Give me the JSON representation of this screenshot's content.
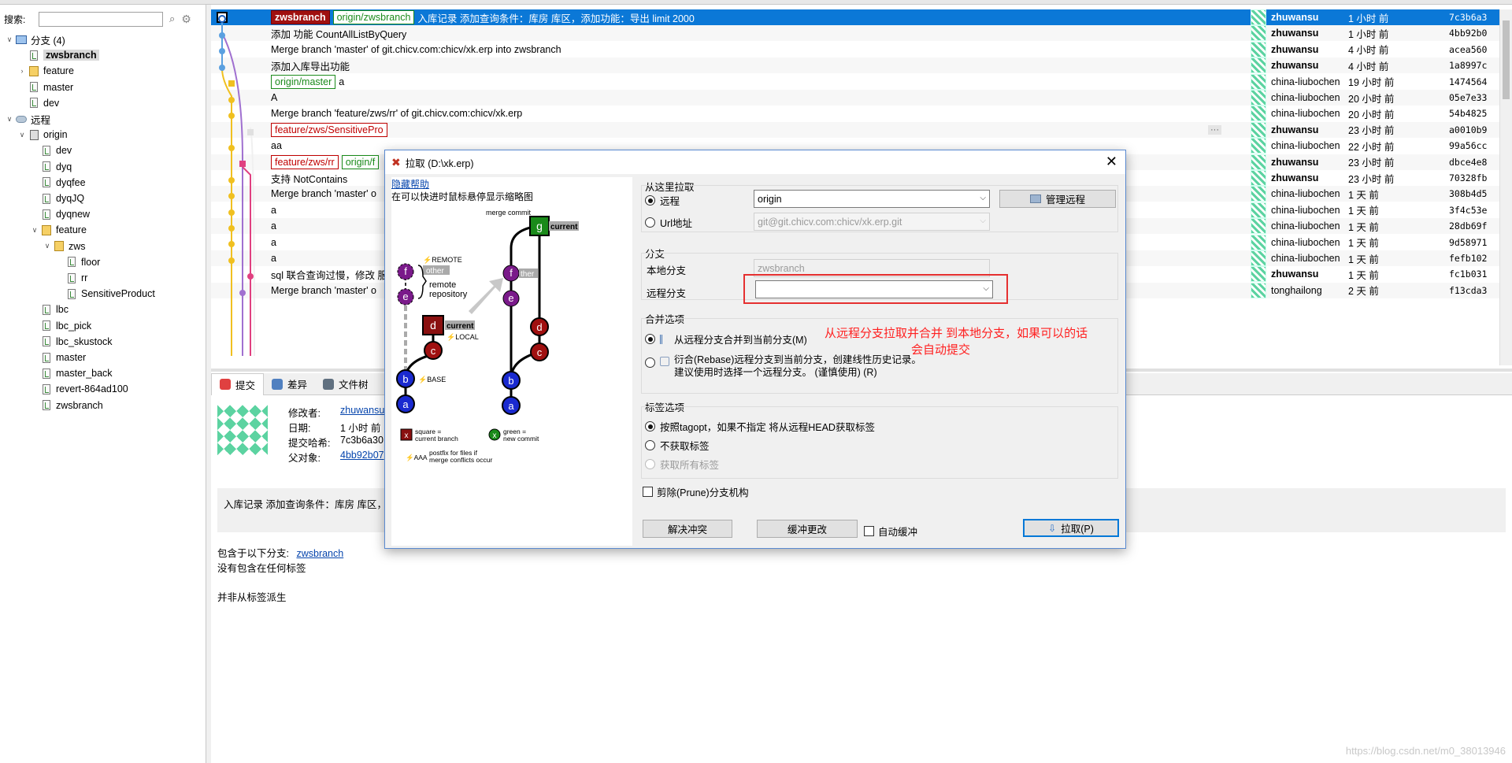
{
  "search": {
    "label": "搜索:",
    "value": ""
  },
  "tree": [
    {
      "label": "分支 (4)",
      "level": 0,
      "expand": "v",
      "icon": "computer-icon"
    },
    {
      "label": "zwsbranch",
      "level": 1,
      "icon": "branch-icon",
      "selected": true
    },
    {
      "label": "feature",
      "level": 1,
      "expand": ">",
      "icon": "folder-icon"
    },
    {
      "label": "master",
      "level": 1,
      "icon": "branch-icon"
    },
    {
      "label": "dev",
      "level": 1,
      "icon": "branch-icon"
    },
    {
      "label": "远程",
      "level": 0,
      "expand": "v",
      "icon": "cloud-icon"
    },
    {
      "label": "origin",
      "level": 1,
      "expand": "v",
      "icon": "server-icon"
    },
    {
      "label": "dev",
      "level": 2,
      "icon": "branch-icon"
    },
    {
      "label": "dyq",
      "level": 2,
      "icon": "branch-icon"
    },
    {
      "label": "dyqfee",
      "level": 2,
      "icon": "branch-icon"
    },
    {
      "label": "dyqJQ",
      "level": 2,
      "icon": "branch-icon"
    },
    {
      "label": "dyqnew",
      "level": 2,
      "icon": "branch-icon"
    },
    {
      "label": "feature",
      "level": 2,
      "expand": "v",
      "icon": "folder-icon"
    },
    {
      "label": "zws",
      "level": 3,
      "expand": "v",
      "icon": "folder-icon"
    },
    {
      "label": "floor",
      "level": 4,
      "icon": "branch-icon"
    },
    {
      "label": "rr",
      "level": 4,
      "icon": "branch-icon"
    },
    {
      "label": "SensitiveProduct",
      "level": 4,
      "icon": "branch-icon"
    },
    {
      "label": "lbc",
      "level": 2,
      "icon": "branch-icon"
    },
    {
      "label": "lbc_pick",
      "level": 2,
      "icon": "branch-icon"
    },
    {
      "label": "lbc_skustock",
      "level": 2,
      "icon": "branch-icon"
    },
    {
      "label": "master",
      "level": 2,
      "icon": "branch-icon"
    },
    {
      "label": "master_back",
      "level": 2,
      "icon": "branch-icon"
    },
    {
      "label": "revert-864ad100",
      "level": 2,
      "icon": "branch-icon"
    },
    {
      "label": "zwsbranch",
      "level": 2,
      "icon": "branch-icon"
    }
  ],
  "log": [
    {
      "tags": [
        {
          "type": "head",
          "text": "zwsbranch"
        },
        {
          "type": "remote",
          "text": "origin/zwsbranch"
        }
      ],
      "message": "入库记录 添加查询条件：库房 库区，添加功能：导出 limit 2000",
      "author": "zhuwansu",
      "bold": true,
      "when": "1 小时 前",
      "hash": "7c3b6a3",
      "selected": true
    },
    {
      "tags": [],
      "message": "添加 功能 CountAllListByQuery",
      "author": "zhuwansu",
      "bold": true,
      "when": "1 小时 前",
      "hash": "4bb92b0"
    },
    {
      "tags": [],
      "message": "Merge branch 'master' of git.chicv.com:chicv/xk.erp into zwsbranch",
      "author": "zhuwansu",
      "bold": true,
      "when": "4 小时 前",
      "hash": "acea560"
    },
    {
      "tags": [],
      "message": "添加入库导出功能",
      "author": "zhuwansu",
      "bold": true,
      "when": "4 小时 前",
      "hash": "1a8997c"
    },
    {
      "tags": [
        {
          "type": "remote",
          "text": "origin/master"
        }
      ],
      "message": "a",
      "author": "china-liubochen",
      "bold": false,
      "when": "19 小时 前",
      "hash": "1474564"
    },
    {
      "tags": [],
      "message": "A",
      "author": "china-liubochen",
      "bold": false,
      "when": "20 小时 前",
      "hash": "05e7e33"
    },
    {
      "tags": [],
      "message": "Merge branch 'feature/zws/rr' of git.chicv.com:chicv/xk.erp",
      "author": "china-liubochen",
      "bold": false,
      "when": "20 小时 前",
      "hash": "54b4825"
    },
    {
      "tags": [
        {
          "type": "feat",
          "text": "feature/zws/SensitivePro"
        }
      ],
      "message": "",
      "author": "zhuwansu",
      "bold": true,
      "when": "23 小时 前",
      "hash": "a0010b9",
      "ellipsis": "···"
    },
    {
      "tags": [],
      "message": "aa",
      "author": "china-liubochen",
      "bold": false,
      "when": "22 小时 前",
      "hash": "99a56cc"
    },
    {
      "tags": [
        {
          "type": "feat",
          "text": "feature/zws/rr"
        },
        {
          "type": "remote",
          "text": "origin/f"
        }
      ],
      "message": "",
      "author": "zhuwansu",
      "bold": true,
      "when": "23 小时 前",
      "hash": "dbce4e8"
    },
    {
      "tags": [],
      "message": "支持 NotContains",
      "author": "zhuwansu",
      "bold": true,
      "when": "23 小时 前",
      "hash": "70328fb"
    },
    {
      "tags": [],
      "message": "Merge branch 'master' o",
      "author": "china-liubochen",
      "bold": false,
      "when": "1 天 前",
      "hash": "308b4d5"
    },
    {
      "tags": [],
      "message": "a",
      "author": "china-liubochen",
      "bold": false,
      "when": "1 天 前",
      "hash": "3f4c53e"
    },
    {
      "tags": [],
      "message": "a",
      "author": "china-liubochen",
      "bold": false,
      "when": "1 天 前",
      "hash": "28db69f"
    },
    {
      "tags": [],
      "message": "a",
      "author": "china-liubochen",
      "bold": false,
      "when": "1 天 前",
      "hash": "9d58971"
    },
    {
      "tags": [],
      "message": "a",
      "author": "china-liubochen",
      "bold": false,
      "when": "1 天 前",
      "hash": "fefb102"
    },
    {
      "tags": [],
      "message": "sql 联合查询过慢，修改 服",
      "author": "zhuwansu",
      "bold": true,
      "when": "1 天 前",
      "hash": "fc1b031"
    },
    {
      "tags": [],
      "message": "Merge branch 'master' o",
      "author": "tonghailong",
      "bold": false,
      "when": "2 天 前",
      "hash": "f13cda3"
    }
  ],
  "detail_tabs": [
    {
      "label": "提交",
      "icon": "commit-icon",
      "color": "#e04040",
      "active": true
    },
    {
      "label": "差异",
      "icon": "diff-icon",
      "color": "#5080c0"
    },
    {
      "label": "文件树",
      "icon": "filetree-icon",
      "color": "#607080"
    }
  ],
  "detail": {
    "modifier_label": "修改者:",
    "modifier": "zhuwansu",
    "date_label": "日期:",
    "date": "1 小时 前",
    "hash_label": "提交哈希:",
    "hash": "7c3b6a30",
    "parent_label": "父对象:",
    "parent": "4bb92b07",
    "message": "入库记录 添加查询条件：库房 库区，",
    "contained_label": "包含于以下分支:",
    "contained_branch": "zwsbranch",
    "no_tags": "没有包含在任何标签",
    "not_from_tag": "并非从标签派生"
  },
  "watermark": "https://blog.csdn.net/m0_38013946",
  "dialog": {
    "title": "拉取 (D:\\xk.erp)",
    "help_link": "隐藏帮助",
    "help_text": "在可以快进时鼠标悬停显示缩略图",
    "diagram": {
      "merge_commit": "merge commit",
      "current": "current",
      "other": "other",
      "ther": "ther",
      "remote_label": "⚡REMOTE",
      "local_label": "⚡LOCAL",
      "base_label": "⚡BASE",
      "remote_repo_1": "remote",
      "remote_repo_2": "repository",
      "legend_square_1": "square =",
      "legend_square_2": "current branch",
      "legend_green_1": "green =",
      "legend_green_2": "new commit",
      "postfix_key": "⚡AAA",
      "postfix_1": "postfix for files if",
      "postfix_2": "merge conflicts occur",
      "nodes": {
        "f": "f",
        "e": "e",
        "d": "d",
        "c": "c",
        "b": "b",
        "a": "a",
        "g": "g",
        "x": "x"
      }
    },
    "pull_from": {
      "title": "从这里拉取",
      "remote_label": "远程",
      "remote_value": "origin",
      "manage_button": "管理远程",
      "url_label": "Url地址",
      "url_value": "git@git.chicv.com:chicv/xk.erp.git"
    },
    "branch": {
      "title": "分支",
      "local_label": "本地分支",
      "local_value": "zwsbranch",
      "remote_label": "远程分支",
      "remote_value": ""
    },
    "merge": {
      "title": "合并选项",
      "opt1": "从远程分支合并到当前分支(M)",
      "opt2_line1": "衍合(Rebase)远程分支到当前分支，创建线性历史记录。",
      "opt2_line2": "建议使用时选择一个远程分支。  (谨慎使用) (R)"
    },
    "annotation_line1": "从远程分支拉取并合并 到本地分支，如果可以的话",
    "annotation_line2": "会自动提交",
    "tags": {
      "title": "标签选项",
      "opt1": "按照tagopt，如果不指定 将从远程HEAD获取标签",
      "opt2": "不获取标签",
      "opt3": "获取所有标签"
    },
    "prune": "剪除(Prune)分支机构",
    "btn_resolve": "解决冲突",
    "btn_stash": "缓冲更改",
    "autostash": "自动缓冲",
    "btn_pull": "拉取(P)"
  },
  "colors": {
    "selection": "#0b78d7",
    "accent_red": "#e53030"
  }
}
